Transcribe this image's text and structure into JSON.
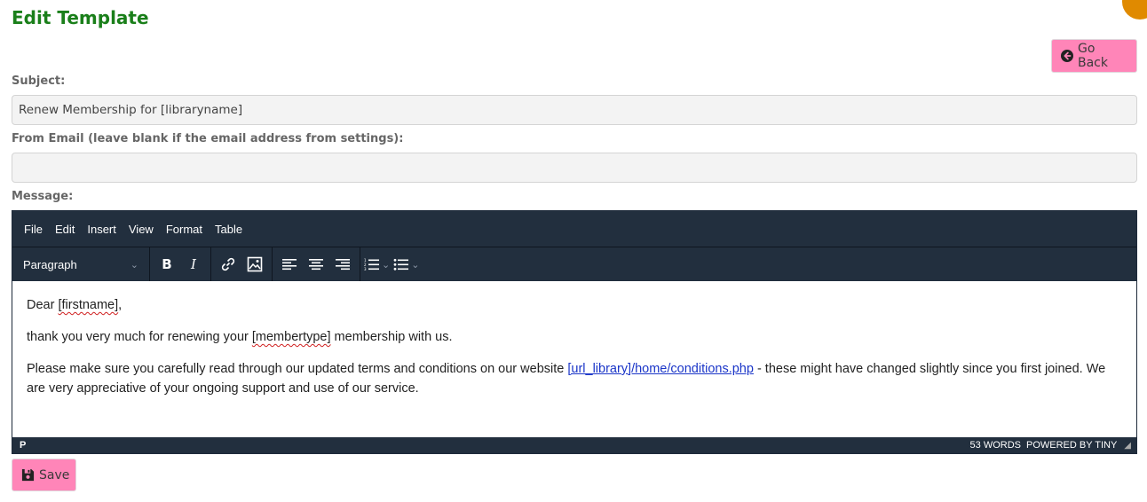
{
  "header": {
    "title": "Edit Template",
    "go_back_label": "Go Back"
  },
  "form": {
    "subject_label": "Subject:",
    "subject_value": "Renew Membership for [libraryname]",
    "from_email_label": "From Email (leave blank if the email address from settings):",
    "from_email_value": "",
    "message_label": "Message:"
  },
  "editor": {
    "menus": [
      "File",
      "Edit",
      "Insert",
      "View",
      "Format",
      "Table"
    ],
    "block_format": "Paragraph",
    "toolbar_icons": [
      "bold-icon",
      "italic-icon",
      "link-icon",
      "image-icon",
      "align-left-icon",
      "align-center-icon",
      "align-right-icon",
      "numbered-list-icon",
      "bullet-list-icon"
    ],
    "content": {
      "p1_prefix": "Dear ",
      "p1_token": "[firstname]",
      "p1_suffix": ",",
      "p2_prefix": "thank you very much for renewing your ",
      "p2_token": "[membertype]",
      "p2_suffix": " membership with us.",
      "p3_prefix": "Please make sure you carefully read through our updated terms and conditions on our website ",
      "p3_link": "[url_library]/home/conditions.php",
      "p3_suffix": " - these might have changed slightly since you first joined. We are very appreciative of your ongoing support and use of our service."
    },
    "status_path": "P",
    "word_count": "53 WORDS",
    "powered_by": "POWERED BY TINY"
  },
  "footer": {
    "save_label": "Save"
  },
  "colors": {
    "title": "#1a7f1a",
    "button": "#ff85b8",
    "editor_chrome": "#222f3e",
    "link": "#1a35c8"
  }
}
